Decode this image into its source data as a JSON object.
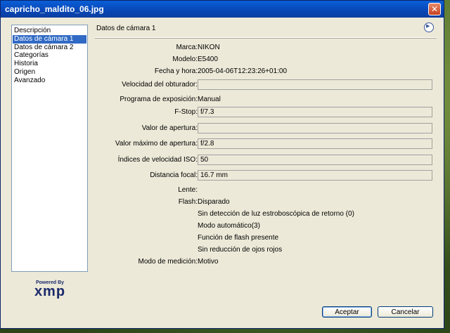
{
  "window": {
    "title": "capricho_maldito_06.jpg"
  },
  "sidebar": {
    "items": [
      {
        "label": "Descripción",
        "selected": false
      },
      {
        "label": "Datos de cámara 1",
        "selected": true
      },
      {
        "label": "Datos de cámara 2",
        "selected": false
      },
      {
        "label": "Categorías",
        "selected": false
      },
      {
        "label": "Historia",
        "selected": false
      },
      {
        "label": "Origen",
        "selected": false
      },
      {
        "label": "Avanzado",
        "selected": false
      }
    ]
  },
  "logo": {
    "powered_by": "Powered By",
    "name": "xmp"
  },
  "panel": {
    "heading": "Datos de cámara 1",
    "fields": {
      "marca": {
        "label": "Marca:",
        "value": "NIKON"
      },
      "modelo": {
        "label": "Modelo:",
        "value": "E5400"
      },
      "fecha": {
        "label": "Fecha y hora:",
        "value": "2005-04-06T12:23:26+01:00"
      },
      "velocidad": {
        "label": "Velocidad del obturador:",
        "value": ""
      },
      "programa": {
        "label": "Programa de exposición:",
        "value": "Manual"
      },
      "fstop": {
        "label": "F-Stop:",
        "value": "f/7.3"
      },
      "apertura": {
        "label": "Valor de apertura:",
        "value": ""
      },
      "apertura_max": {
        "label": "Valor máximo de apertura:",
        "value": "f/2.8"
      },
      "iso": {
        "label": "Índices de velocidad ISO:",
        "value": "50"
      },
      "focal": {
        "label": "Distancia focal:",
        "value": "16.7 mm"
      },
      "lente": {
        "label": "Lente:",
        "value": ""
      },
      "flash": {
        "label": "Flash:",
        "values": [
          "Disparado",
          "Sin detección de luz estroboscópica de retorno (0)",
          "Modo automático(3)",
          "Función de flash presente",
          "Sin reducción de ojos rojos"
        ]
      },
      "medicion": {
        "label": "Modo de medición:",
        "value": "Motivo"
      }
    }
  },
  "buttons": {
    "ok": "Aceptar",
    "cancel": "Cancelar"
  }
}
